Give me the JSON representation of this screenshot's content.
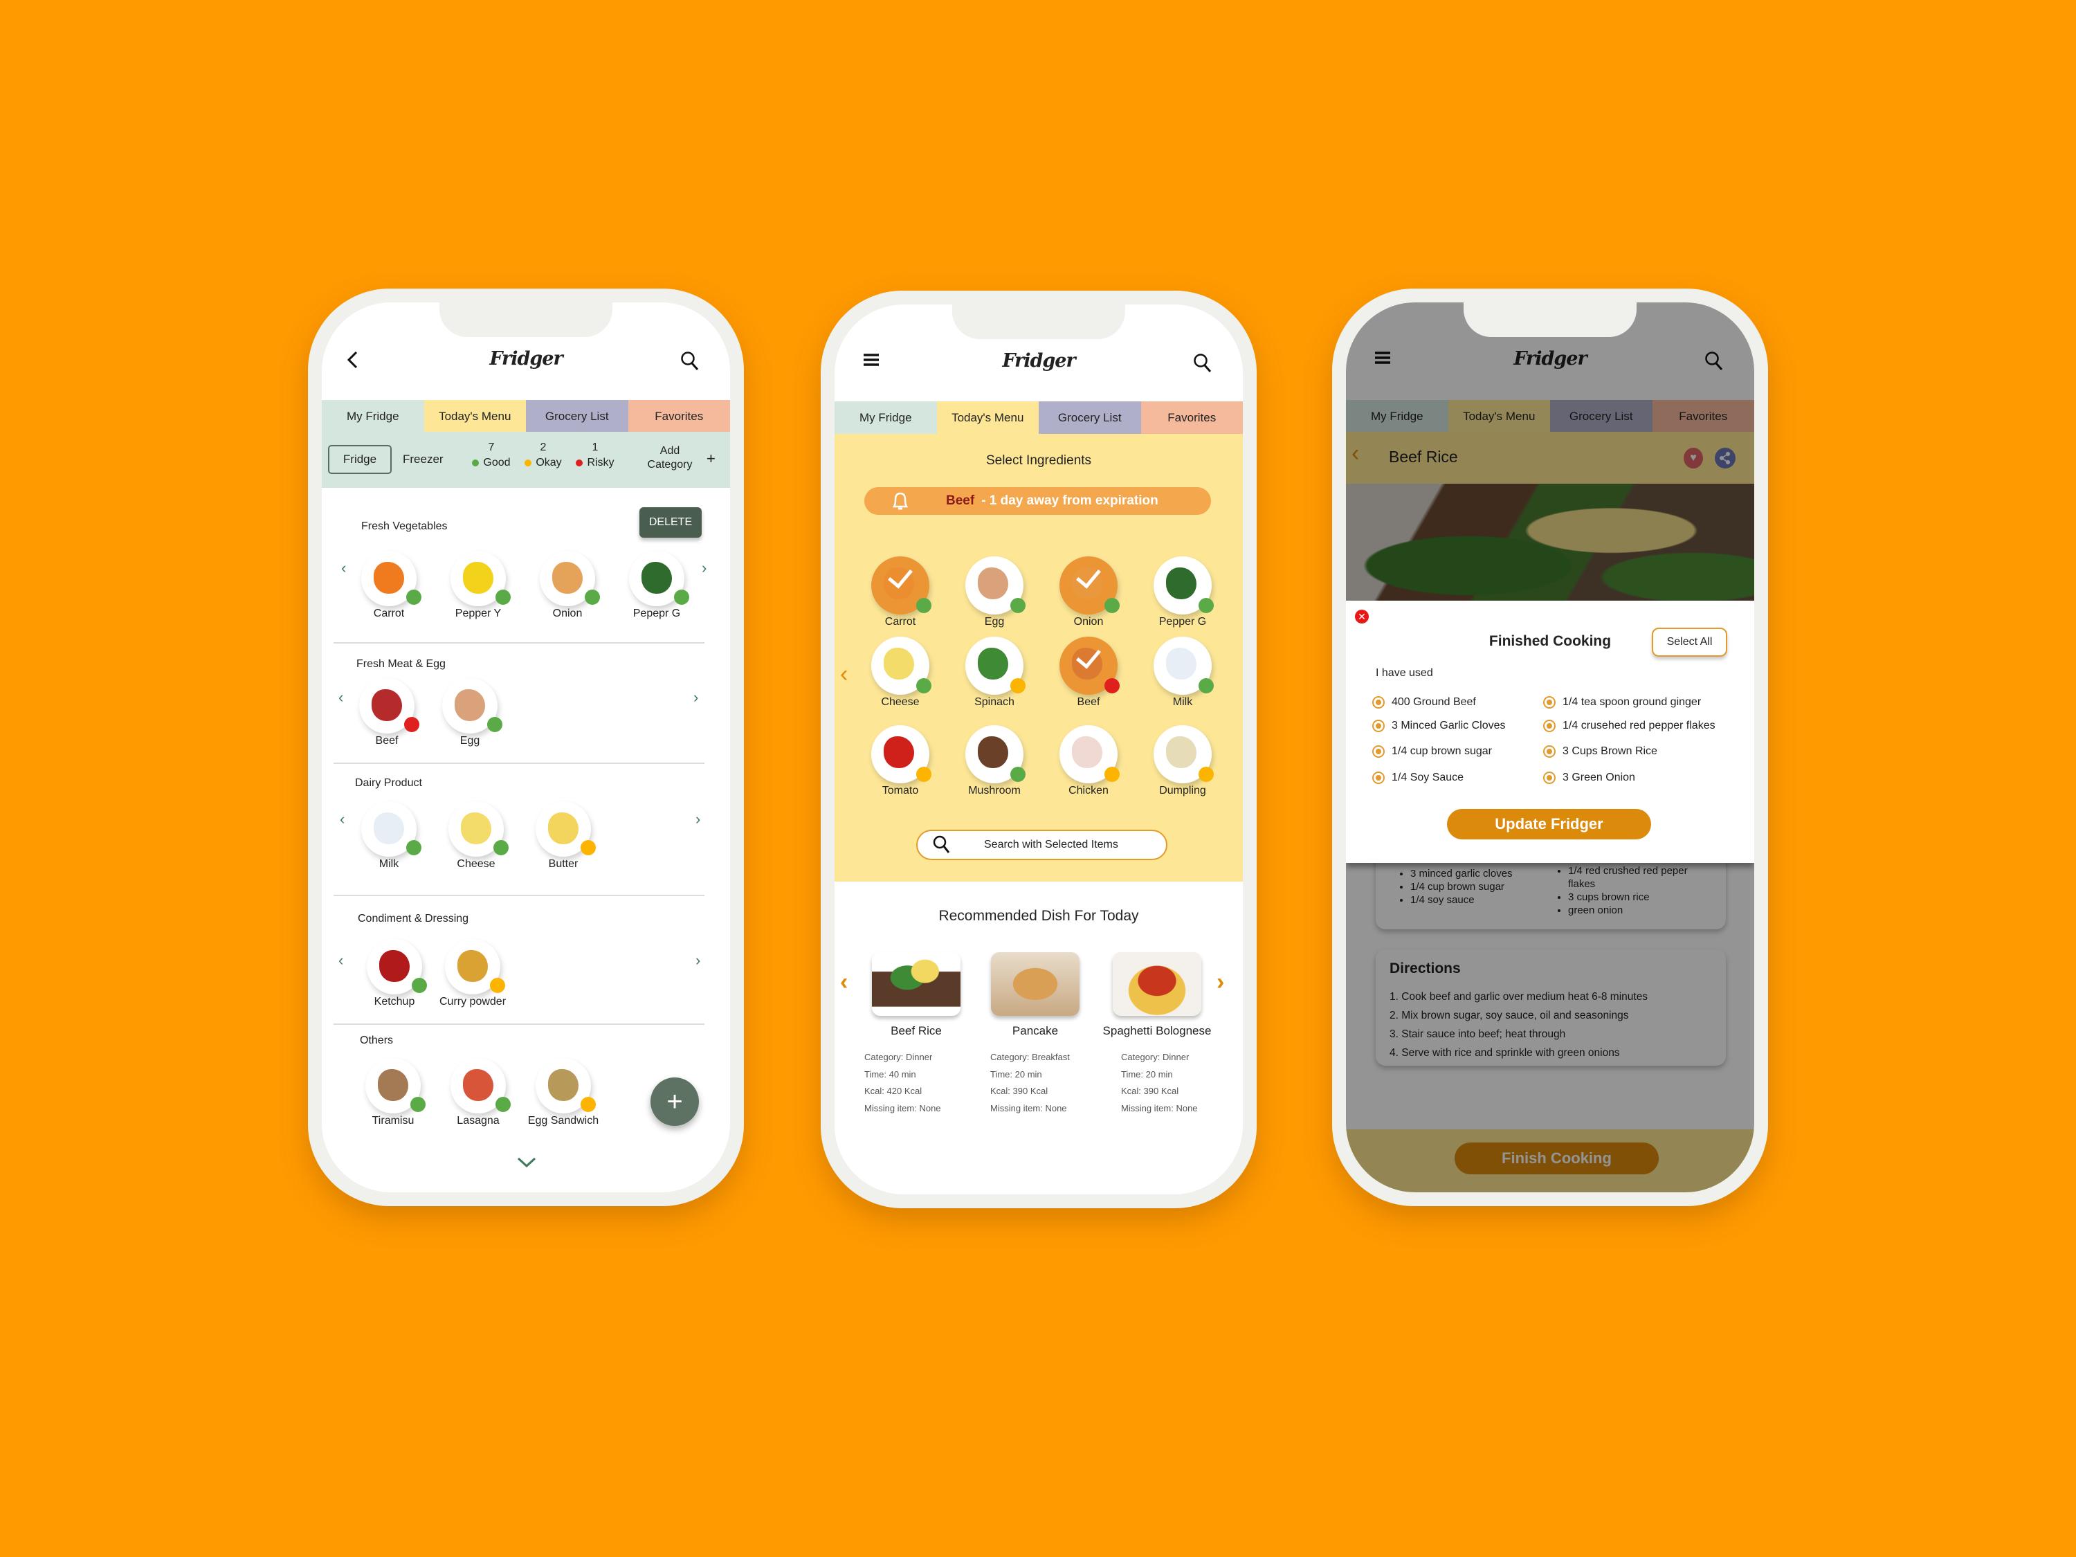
{
  "app_title": "Fridger",
  "colors": {
    "background": "#ff9a00",
    "good": "#5aab47",
    "okay": "#fdb400",
    "risky": "#e01f1f",
    "accent": "#dc8a0c",
    "dark_green": "#4a5e4f"
  },
  "tabs": [
    "My Fridge",
    "Today's Menu",
    "Grocery List",
    "Favorites"
  ],
  "fridge_screen": {
    "filter": {
      "fridge": "Fridge",
      "freezer": "Freezer",
      "good_count": "7",
      "good": "Good",
      "okay_count": "2",
      "okay": "Okay",
      "risky_count": "1",
      "risky": "Risky",
      "add_category": "Add Category",
      "add": "+"
    },
    "delete_label": "DELETE",
    "add_label": "+",
    "sections": [
      {
        "title": "Fresh Vegetables",
        "items": [
          {
            "label": "Carrot",
            "status": "good",
            "color": "#f07a1e"
          },
          {
            "label": "Pepper Y",
            "status": "good",
            "color": "#f2d21a"
          },
          {
            "label": "Onion",
            "status": "good",
            "color": "#e5a35a"
          },
          {
            "label": "Pepepr G",
            "status": "good",
            "color": "#2f6b2c"
          }
        ]
      },
      {
        "title": "Fresh Meat & Egg",
        "items": [
          {
            "label": "Beef",
            "status": "risky",
            "color": "#b52a2a"
          },
          {
            "label": "Egg",
            "status": "good",
            "color": "#d9a27a"
          }
        ]
      },
      {
        "title": "Dairy Product",
        "items": [
          {
            "label": "Milk",
            "status": "good",
            "color": "#e8eef5"
          },
          {
            "label": "Cheese",
            "status": "good",
            "color": "#f4dc6a"
          },
          {
            "label": "Butter",
            "status": "okay",
            "color": "#f3d45c"
          }
        ]
      },
      {
        "title": "Condiment & Dressing",
        "items": [
          {
            "label": "Ketchup",
            "status": "good",
            "color": "#b01a1a"
          },
          {
            "label": "Curry powder",
            "status": "okay",
            "color": "#d9a233"
          }
        ]
      },
      {
        "title": "Others",
        "items": [
          {
            "label": "Tiramisu",
            "status": "good",
            "color": "#a47a55"
          },
          {
            "label": "Lasagna",
            "status": "good",
            "color": "#d9553a"
          },
          {
            "label": "Egg Sandwich",
            "status": "okay",
            "color": "#b79a5a"
          }
        ]
      }
    ]
  },
  "menu_screen": {
    "heading": "Select Ingredients",
    "alert_item": "Beef",
    "alert_text": "- 1 day away from expiration",
    "ingredients": [
      {
        "label": "Carrot",
        "status": "good",
        "checked": true,
        "color": "#f07a1e"
      },
      {
        "label": "Egg",
        "status": "good",
        "checked": false,
        "color": "#d9a27a"
      },
      {
        "label": "Onion",
        "status": "good",
        "checked": true,
        "color": "#e5a35a"
      },
      {
        "label": "Pepper G",
        "status": "good",
        "checked": false,
        "color": "#2f6b2c"
      },
      {
        "label": "Cheese",
        "status": "good",
        "checked": false,
        "color": "#f4dc6a"
      },
      {
        "label": "Spinach",
        "status": "okay",
        "checked": false,
        "color": "#3f8a35"
      },
      {
        "label": "Beef",
        "status": "risky",
        "checked": true,
        "color": "#b52a2a"
      },
      {
        "label": "Milk",
        "status": "good",
        "checked": false,
        "color": "#e8eef5"
      },
      {
        "label": "Tomato",
        "status": "okay",
        "checked": false,
        "color": "#d0201a"
      },
      {
        "label": "Mushroom",
        "status": "good",
        "checked": false,
        "color": "#6b4028"
      },
      {
        "label": "Chicken",
        "status": "okay",
        "checked": false,
        "color": "#f0d9d2"
      },
      {
        "label": "Dumpling",
        "status": "okay",
        "checked": false,
        "color": "#e6dcb8"
      }
    ],
    "search_label": "Search with Selected Items",
    "recommended_title": "Recommended Dish For Today",
    "dishes": [
      {
        "name": "Beef Rice",
        "category": "Category: Dinner",
        "time": "Time: 40 min",
        "kcal": "Kcal: 420 Kcal",
        "missing": "Missing item: None"
      },
      {
        "name": "Pancake",
        "category": "Category: Breakfast",
        "time": "Time: 20 min",
        "kcal": "Kcal: 390 Kcal",
        "missing": "Missing item: None"
      },
      {
        "name": "Spaghetti Bolognese",
        "category": "Category: Dinner",
        "time": "Time: 20 min",
        "kcal": "Kcal: 390 Kcal",
        "missing": "Missing item: None"
      }
    ]
  },
  "recipe_screen": {
    "title": "Beef Rice",
    "modal": {
      "title": "Finished Cooking",
      "select_all": "Select All",
      "subtitle": "I have used",
      "items_left": [
        "400 Ground Beef",
        "3 Minced Garlic Cloves",
        "1/4 cup brown sugar",
        "1/4 Soy Sauce"
      ],
      "items_right": [
        "1/4 tea spoon ground ginger",
        "1/4 crusehed red pepper flakes",
        "3 Cups Brown Rice",
        "3 Green Onion"
      ],
      "update_button": "Update Fridger"
    },
    "ingredients_left": [
      "3 minced garlic cloves",
      "1/4 cup brown sugar",
      "1/4 soy sauce"
    ],
    "ingredients_right": [
      "1/4 red crushed red peper flakes",
      "3 cups brown rice",
      "green onion"
    ],
    "directions_title": "Directions",
    "directions": [
      "1. Cook beef and garlic over medium heat 6-8 minutes",
      "2. Mix brown sugar, soy sauce, oil and seasonings",
      "3. Stair sauce into beef; heat through",
      "4. Serve with rice and sprinkle with green onions"
    ],
    "finish_button": "Finish Cooking"
  }
}
